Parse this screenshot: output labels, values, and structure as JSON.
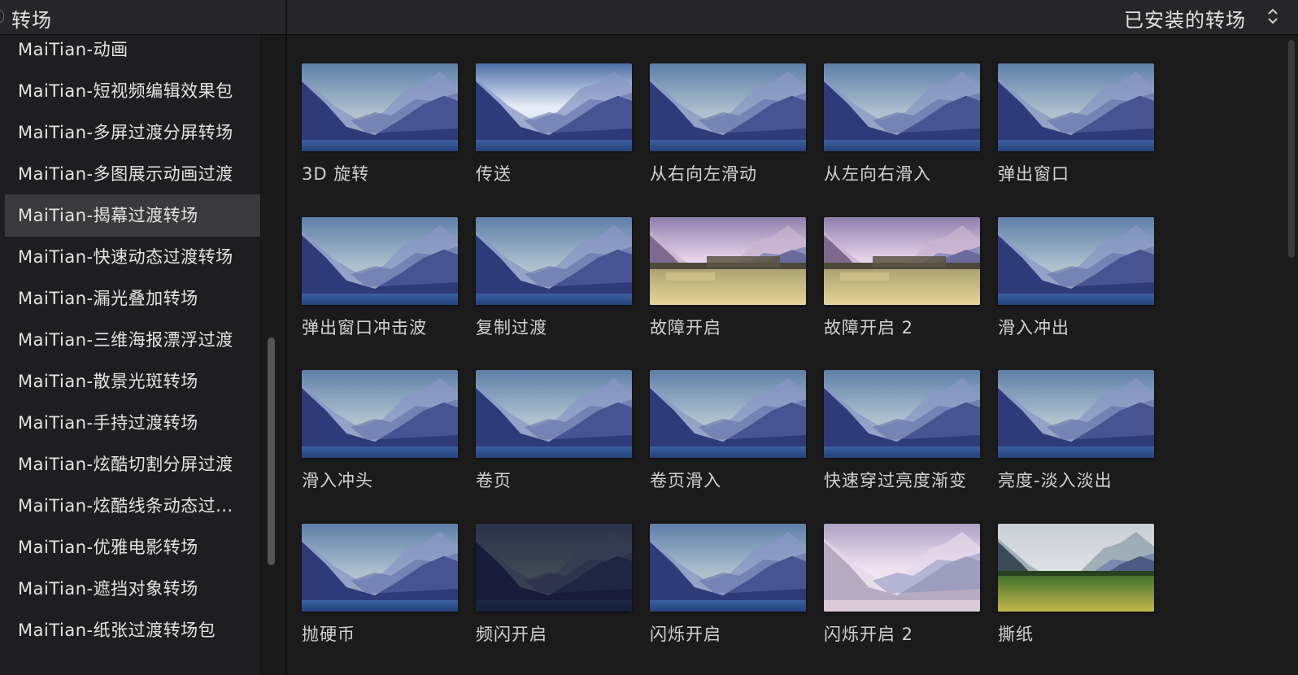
{
  "header": {
    "title": "转场",
    "installed_label": "已安装的转场"
  },
  "sidebar": {
    "items": [
      {
        "label": "MaiTian-动画",
        "selected": false
      },
      {
        "label": "MaiTian-短视频编辑效果包",
        "selected": false
      },
      {
        "label": "MaiTian-多屏过渡分屏转场",
        "selected": false
      },
      {
        "label": "MaiTian-多图展示动画过渡",
        "selected": false
      },
      {
        "label": "MaiTian-揭幕过渡转场",
        "selected": true
      },
      {
        "label": "MaiTian-快速动态过渡转场",
        "selected": false
      },
      {
        "label": "MaiTian-漏光叠加转场",
        "selected": false
      },
      {
        "label": "MaiTian-三维海报漂浮过渡",
        "selected": false
      },
      {
        "label": "MaiTian-散景光斑转场",
        "selected": false
      },
      {
        "label": "MaiTian-手持过渡转场",
        "selected": false
      },
      {
        "label": "MaiTian-炫酷切割分屏过渡",
        "selected": false
      },
      {
        "label": "MaiTian-炫酷线条动态过...",
        "selected": false
      },
      {
        "label": "MaiTian-优雅电影转场",
        "selected": false
      },
      {
        "label": "MaiTian-遮挡对象转场",
        "selected": false
      },
      {
        "label": "MaiTian-纸张过渡转场包",
        "selected": false
      }
    ]
  },
  "grid": {
    "tiles": [
      {
        "label": "3D 旋转",
        "thumb": "mountain-blue"
      },
      {
        "label": "传送",
        "thumb": "mountain-warp"
      },
      {
        "label": "从右向左滑动",
        "thumb": "mountain-blue"
      },
      {
        "label": "从左向右滑入",
        "thumb": "mountain-blue"
      },
      {
        "label": "弹出窗口",
        "thumb": "mountain-blue"
      },
      {
        "label": "弹出窗口冲击波",
        "thumb": "mountain-blue"
      },
      {
        "label": "复制过渡",
        "thumb": "mountain-blue"
      },
      {
        "label": "故障开启",
        "thumb": "mountain-glitch"
      },
      {
        "label": "故障开启 2",
        "thumb": "mountain-glitch2"
      },
      {
        "label": "滑入冲出",
        "thumb": "mountain-blue"
      },
      {
        "label": "滑入冲头",
        "thumb": "mountain-blue"
      },
      {
        "label": "卷页",
        "thumb": "mountain-blue"
      },
      {
        "label": "卷页滑入",
        "thumb": "mountain-blue"
      },
      {
        "label": "快速穿过亮度渐变",
        "thumb": "mountain-blue"
      },
      {
        "label": "亮度-淡入淡出",
        "thumb": "mountain-blue"
      },
      {
        "label": "抛硬币",
        "thumb": "mountain-blue"
      },
      {
        "label": "频闪开启",
        "thumb": "mountain-dark"
      },
      {
        "label": "闪烁开启",
        "thumb": "mountain-blue"
      },
      {
        "label": "闪烁开启 2",
        "thumb": "mountain-flicker"
      },
      {
        "label": "撕纸",
        "thumb": "mountain-green"
      }
    ]
  },
  "colors": {
    "background": "#1b1b1c",
    "selected_row": "#3a3a3c",
    "text": "#d6d6d6"
  }
}
